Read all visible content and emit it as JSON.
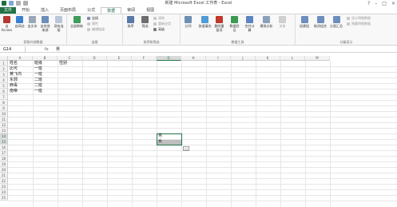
{
  "window": {
    "title": "新建 Microsoft Excel 工作表 - Excel"
  },
  "tabs": [
    "文件",
    "开始",
    "插入",
    "页面布局",
    "公式",
    "数据",
    "审阅",
    "视图"
  ],
  "ribbon": {
    "get_external": {
      "buttons": [
        "自 Access",
        "自网站",
        "自文本",
        "自其他来源",
        "现有连接"
      ],
      "label": "获取外部数据"
    },
    "connections": {
      "refresh": "全部刷新",
      "items": [
        "连接",
        "属性",
        "编辑链接"
      ],
      "label": "连接"
    },
    "sort_filter": {
      "buttons": [
        "排序",
        "筛选"
      ],
      "items": [
        "清除",
        "重新应用",
        "高级"
      ],
      "label": "排序和筛选"
    },
    "data_tools": {
      "buttons": [
        "分列",
        "快速填充",
        "删除重复项",
        "数据验证",
        "合并计算",
        "模拟分析",
        "关系"
      ],
      "label": "数据工具"
    },
    "outline": {
      "buttons": [
        "创建组",
        "取消组合",
        "分类汇总"
      ],
      "items": [
        "显示明细数据",
        "隐藏明细数据"
      ],
      "label": "分级显示"
    }
  },
  "formula_bar": {
    "name_box": "G14",
    "fx": "fx",
    "value": "男"
  },
  "columns": [
    "A",
    "B",
    "C",
    "D",
    "E",
    "F",
    "G",
    "H",
    "I",
    "J",
    "K",
    "L",
    "M"
  ],
  "rows": [
    "1",
    "2",
    "3",
    "4",
    "5",
    "6",
    "7",
    "8",
    "9",
    "10",
    "11",
    "12",
    "13",
    "14",
    "15",
    "16",
    "17",
    "18",
    "19",
    "20",
    "21",
    "22",
    "23",
    "24",
    "25"
  ],
  "cells": {
    "A1": "姓名",
    "B1": "班级",
    "C1": "性别",
    "A2": "比可",
    "B2": "一班",
    "A3": "黄飞鸿",
    "B3": "一班",
    "A4": "东邪",
    "B4": "二班",
    "A5": "西毒",
    "B5": "二班",
    "A6": "南帝",
    "B6": "一班",
    "G14": "男",
    "G15": "女"
  },
  "paste_options": "☐"
}
